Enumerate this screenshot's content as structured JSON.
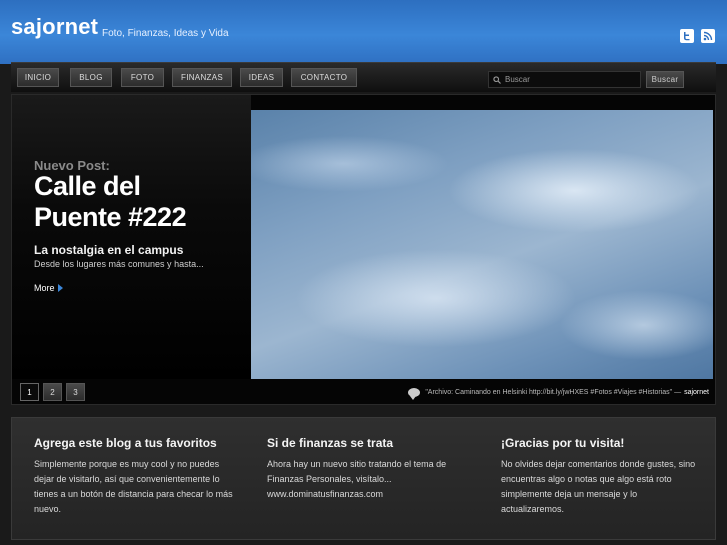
{
  "header": {
    "title": "sajornet",
    "tagline": "Foto, Finanzas, Ideas y Vida",
    "icons": [
      "twitter-icon",
      "rss-icon"
    ]
  },
  "nav": {
    "items": [
      "INICIO",
      "BLOG",
      "FOTO",
      "FINANZAS",
      "IDEAS",
      "CONTACTO"
    ],
    "search_placeholder": "Buscar",
    "search_button": "Buscar"
  },
  "featured": {
    "kicker": "Nuevo Post:",
    "title": "Calle del Puente #222",
    "subtitle": "La nostalgia en el campus",
    "excerpt": "Desde los lugares más comunes y hasta...",
    "more": "More",
    "pages": [
      "1",
      "2",
      "3"
    ],
    "tweet": "\"Archivo: Caminando en Helsinki http://bit.ly/jwHXES #Fotos #Viajes #Historias\" —",
    "tweet_author": "sajornet"
  },
  "widgets": [
    {
      "title": "Agrega este blog a tus favoritos",
      "body": "Simplemente porque es muy cool y no puedes dejar de visitarlo, así que convenientemente lo tienes a un botón de distancia para checar lo más nuevo."
    },
    {
      "title": "Si de finanzas se trata",
      "body": "Ahora hay un nuevo sitio tratando el tema de Finanzas Personales, visítalo... www.dominatusfinanzas.com"
    },
    {
      "title": "¡Gracias por tu visita!",
      "body": "No olvides dejar comentarios donde gustes, sino encuentras algo o notas que algo está roto simplemente deja un mensaje y lo actualizaremos."
    }
  ],
  "colors": {
    "header_blue": "#3b86d8",
    "accent_arrow": "#3b86d8"
  }
}
